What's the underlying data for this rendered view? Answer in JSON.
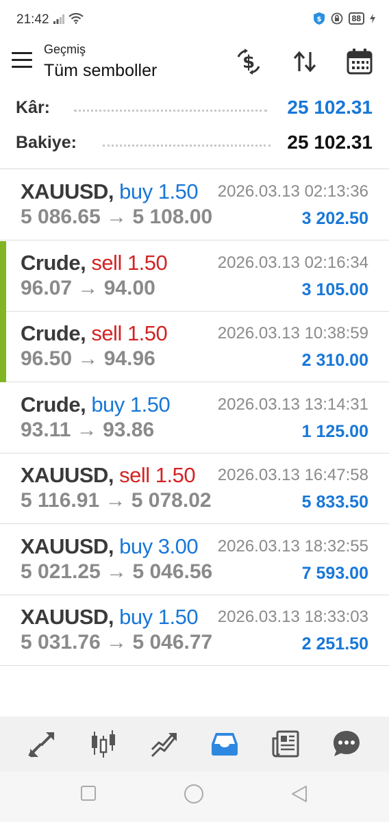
{
  "status": {
    "time": "21:42",
    "battery": "88"
  },
  "header": {
    "subtitle": "Geçmiş",
    "title": "Tüm semboller"
  },
  "summary": {
    "profit_label": "Kâr:",
    "profit_value": "25 102.31",
    "balance_label": "Bakiye:",
    "balance_value": "25 102.31"
  },
  "trades": [
    {
      "symbol": "XAUUSD,",
      "direction": "buy 1.50",
      "type": "buy",
      "time": "2026.03.13 02:13:36",
      "prices": "5 086.65 → 5 108.00",
      "profit": "3 202.50",
      "marker": false
    },
    {
      "symbol": "Crude,",
      "direction": "sell 1.50",
      "type": "sell",
      "time": "2026.03.13 02:16:34",
      "prices": "96.07 → 94.00",
      "profit": "3 105.00",
      "marker": true
    },
    {
      "symbol": "Crude,",
      "direction": "sell 1.50",
      "type": "sell",
      "time": "2026.03.13 10:38:59",
      "prices": "96.50 → 94.96",
      "profit": "2 310.00",
      "marker": true
    },
    {
      "symbol": "Crude,",
      "direction": "buy 1.50",
      "type": "buy",
      "time": "2026.03.13 13:14:31",
      "prices": "93.11 → 93.86",
      "profit": "1 125.00",
      "marker": false
    },
    {
      "symbol": "XAUUSD,",
      "direction": "sell 1.50",
      "type": "sell",
      "time": "2026.03.13 16:47:58",
      "prices": "5 116.91 → 5 078.02",
      "profit": "5 833.50",
      "marker": false
    },
    {
      "symbol": "XAUUSD,",
      "direction": "buy 3.00",
      "type": "buy",
      "time": "2026.03.13 18:32:55",
      "prices": "5 021.25 → 5 046.56",
      "profit": "7 593.00",
      "marker": false
    },
    {
      "symbol": "XAUUSD,",
      "direction": "buy 1.50",
      "type": "buy",
      "time": "2026.03.13 18:33:03",
      "prices": "5 031.76 → 5 046.77",
      "profit": "2 251.50",
      "marker": false
    }
  ],
  "nav": {
    "items": [
      "quotes-icon",
      "chart-icon",
      "trade-icon",
      "history-icon",
      "news-icon",
      "chat-icon"
    ],
    "active": "history-icon"
  },
  "colors": {
    "accent": "#1877d8",
    "sell": "#d32323",
    "marker": "#82b523"
  }
}
